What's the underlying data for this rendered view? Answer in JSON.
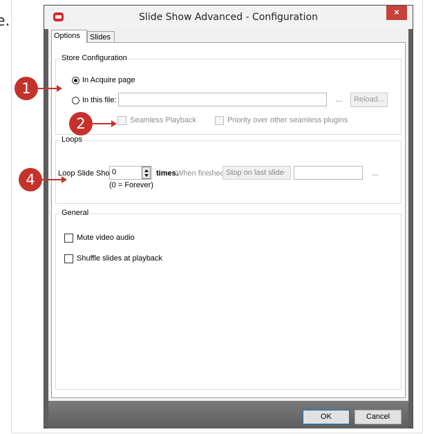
{
  "doc_fragment": "e.",
  "window": {
    "title": "Slide Show Advanced - Configuration",
    "close_glyph": "×"
  },
  "tabs": [
    {
      "label": "Options",
      "active": true
    },
    {
      "label": "Slides",
      "active": false
    }
  ],
  "store_configuration": {
    "legend": "Store Configuration",
    "in_acquire_label": "In Acquire page",
    "in_acquire_checked": true,
    "in_file_label": "In this file:",
    "in_file_checked": false,
    "file_path_value": "",
    "browse_label": "...",
    "reload_label": "Reload...",
    "seamless_label": "Seamless Playback",
    "seamless_checked": false,
    "priority_label": "Priority over other seamless plugins",
    "priority_checked": false
  },
  "loops": {
    "legend": "Loops",
    "loop_label": "Loop Slide Show",
    "loop_value": "0",
    "times_label": "times.",
    "forever_note": "(0 = Forever)",
    "when_finished_label": "When finished",
    "when_finished_value": "Stop on last slide",
    "target_value": "",
    "browse_label": "..."
  },
  "general": {
    "legend": "General",
    "mute_label": "Mute video audio",
    "mute_checked": false,
    "shuffle_label": "Shuffle slides at playback",
    "shuffle_checked": false
  },
  "footer": {
    "ok_label": "OK",
    "cancel_label": "Cancel"
  },
  "annotations": [
    {
      "number": "1"
    },
    {
      "number": "2"
    },
    {
      "number": "4"
    }
  ],
  "colors": {
    "marker": "#c4322b",
    "close_button": "#c7413a"
  },
  "icons": {
    "app": "red-camera-app-icon",
    "close": "close-icon",
    "spinner": "up-down-spinner-icon",
    "dropdown": "chevron-down-icon"
  }
}
